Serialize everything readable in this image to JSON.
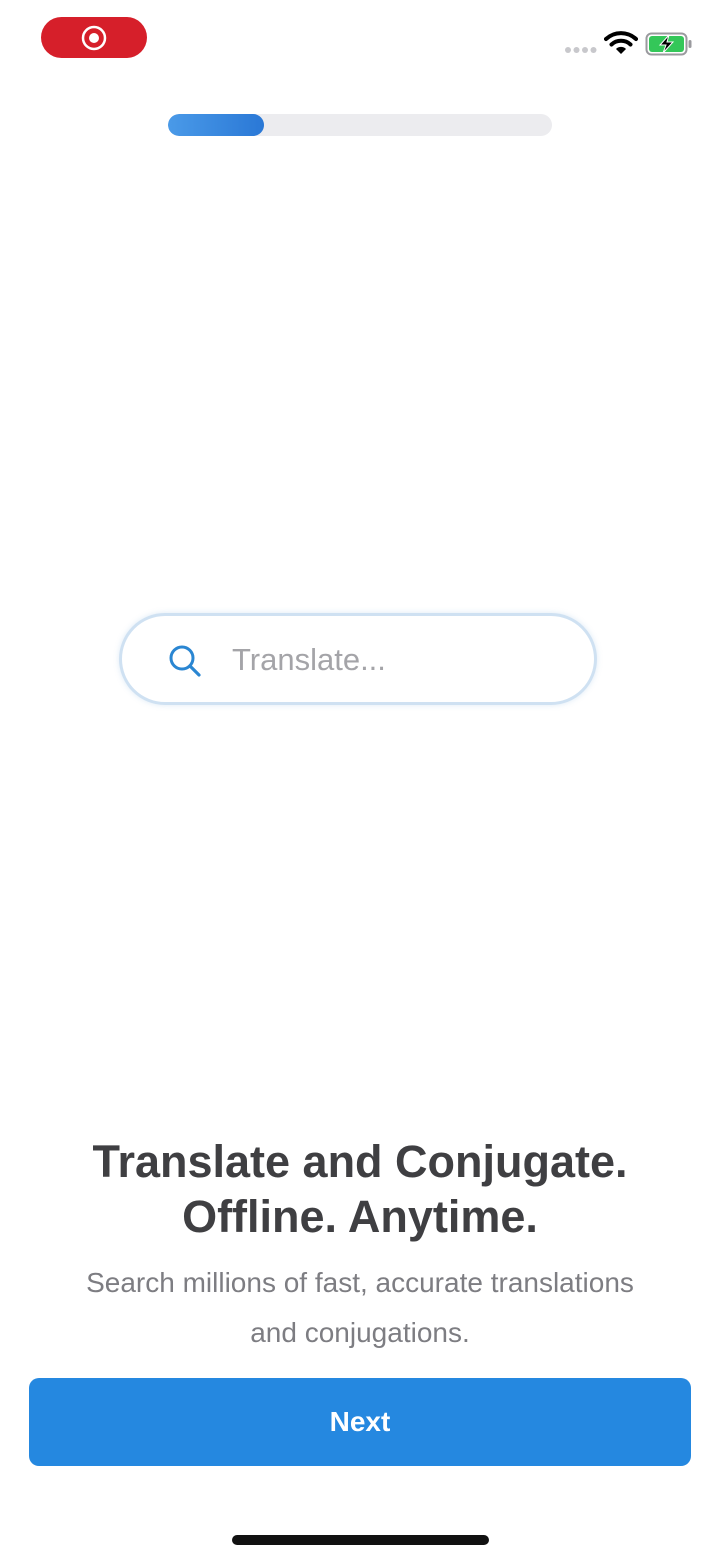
{
  "status_bar": {
    "record_icon": "screen-record-icon",
    "record_color": "#d61f2a",
    "signal_icon": "signal-dots-icon",
    "wifi_icon": "wifi-icon",
    "battery_icon": "battery-charging-icon",
    "battery_color": "#34c759"
  },
  "onboarding": {
    "progress_fraction": 0.25,
    "progress_color": "#2a78d6"
  },
  "search": {
    "icon": "search-icon",
    "placeholder": "Translate...",
    "value": ""
  },
  "headline": {
    "line1": "Translate and Conjugate.",
    "line2": "Offline. Anytime."
  },
  "subtitle": {
    "line1": "Search millions of fast, accurate translations",
    "line2": "and conjugations."
  },
  "next_button": {
    "label": "Next",
    "color": "#2588e0"
  }
}
